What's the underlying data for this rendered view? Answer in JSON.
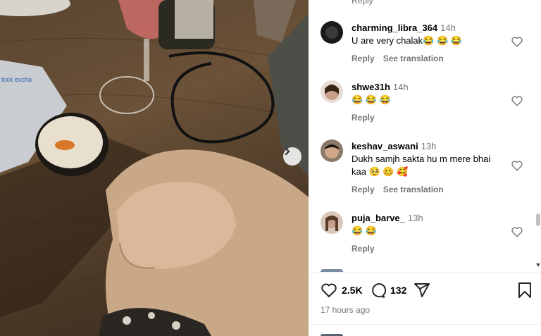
{
  "photo": {
    "alt_text_visible": "",
    "next_icon": "chevron-right-icon"
  },
  "comments_top_reply": "Reply",
  "comments": [
    {
      "username": "charming_libra_364",
      "time": "14h",
      "text": "U are very chalak😂 😂 😂",
      "actions": [
        "Reply",
        "See translation"
      ],
      "avatar_color": "#1a1a1a"
    },
    {
      "username": "shwe31h",
      "time": "14h",
      "text": "😂 😂 😂",
      "actions": [
        "Reply"
      ],
      "avatar_color": "#c9a08a"
    },
    {
      "username": "keshav_aswani",
      "time": "13h",
      "text": "Dukh samjh sakta hu m mere bhai kaa 🥺 🥴 🥰",
      "actions": [
        "Reply",
        "See translation"
      ],
      "avatar_color": "#6d5a4a"
    },
    {
      "username": "puja_barve_",
      "time": "13h",
      "text": "😂 😂",
      "actions": [
        "Reply"
      ],
      "avatar_color": "#b89a8a"
    }
  ],
  "post_actions": {
    "likes": "2.5K",
    "comments": "132",
    "like_icon": "heart-icon",
    "comment_icon": "comment-icon",
    "share_icon": "share-icon",
    "save_icon": "bookmark-icon"
  },
  "time_ago": "17 hours ago"
}
